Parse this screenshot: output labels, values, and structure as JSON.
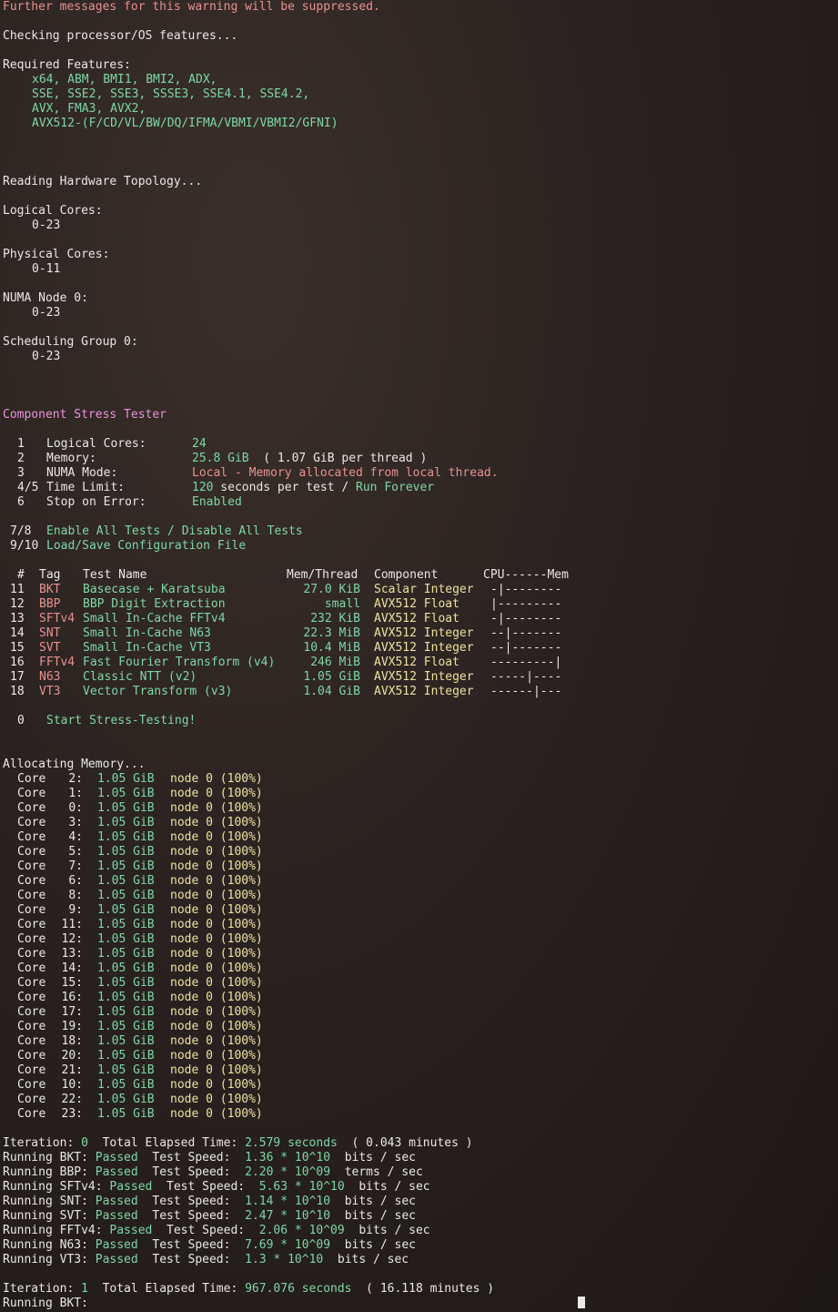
{
  "colors": {
    "text": "#e8e8e8",
    "green": "#7fd6a4",
    "red": "#e7918f",
    "magenta": "#e792d9"
  },
  "header": {
    "suppressed": "Further messages for this warning will be suppressed.",
    "checking": "Checking processor/OS features...",
    "required_title": "Required Features:",
    "features": [
      "x64, ABM, BMI1, BMI2, ADX,",
      "SSE, SSE2, SSE3, SSSE3, SSE4.1, SSE4.2,",
      "AVX, FMA3, AVX2,",
      "AVX512-(F/CD/VL/BW/DQ/IFMA/VBMI/VBMI2/GFNI)"
    ],
    "reading": "Reading Hardware Topology...",
    "topology": [
      {
        "label": "Logical Cores:",
        "value": "0-23"
      },
      {
        "label": "Physical Cores:",
        "value": "0-11"
      },
      {
        "label": "NUMA Node 0:",
        "value": "0-23"
      },
      {
        "label": "Scheduling Group 0:",
        "value": "0-23"
      }
    ]
  },
  "tester": {
    "title": "Component Stress Tester",
    "settings": [
      {
        "num": "1",
        "label": "Logical Cores:",
        "value": "24",
        "suffix": ""
      },
      {
        "num": "2",
        "label": "Memory:",
        "value": "25.8 GiB",
        "suffix": "  ( 1.07 GiB per thread )"
      },
      {
        "num": "3",
        "label": "NUMA Mode:",
        "value": "Local - Memory allocated from local thread.",
        "suffix": ""
      },
      {
        "num": "4/5",
        "label": "Time Limit:",
        "value": "120",
        "suffix": " seconds per test / ",
        "extra": "Run Forever"
      },
      {
        "num": "6",
        "label": "Stop on Error:",
        "value": "Enabled",
        "suffix": ""
      }
    ],
    "opt_78_num": "7/8",
    "opt_78": "Enable All Tests / Disable All Tests",
    "opt_910_num": "9/10",
    "opt_910": "Load/Save Configuration File",
    "columns": {
      "num": "#",
      "tag": "Tag",
      "name": "Test Name",
      "mem": "Mem/Thread",
      "comp": "Component",
      "bar": "CPU------Mem"
    },
    "tests": [
      {
        "num": "11",
        "tag": "BKT",
        "name": "Basecase + Karatsuba",
        "mem": "27.0 KiB",
        "comp": "Scalar Integer",
        "bar": "-|--------"
      },
      {
        "num": "12",
        "tag": "BBP",
        "name": "BBP Digit Extraction",
        "mem": "small",
        "comp": "AVX512 Float",
        "bar": "|---------"
      },
      {
        "num": "13",
        "tag": "SFTv4",
        "name": "Small In-Cache FFTv4",
        "mem": "232 KiB",
        "comp": "AVX512 Float",
        "bar": "-|--------"
      },
      {
        "num": "14",
        "tag": "SNT",
        "name": "Small In-Cache N63",
        "mem": "22.3 MiB",
        "comp": "AVX512 Integer",
        "bar": "--|-------"
      },
      {
        "num": "15",
        "tag": "SVT",
        "name": "Small In-Cache VT3",
        "mem": "10.4 MiB",
        "comp": "AVX512 Integer",
        "bar": "--|-------"
      },
      {
        "num": "16",
        "tag": "FFTv4",
        "name": "Fast Fourier Transform (v4)",
        "mem": "246 MiB",
        "comp": "AVX512 Float",
        "bar": "---------|"
      },
      {
        "num": "17",
        "tag": "N63",
        "name": "Classic NTT (v2)",
        "mem": "1.05 GiB",
        "comp": "AVX512 Integer",
        "bar": "-----|----"
      },
      {
        "num": "18",
        "tag": "VT3",
        "name": "Vector Transform (v3)",
        "mem": "1.04 GiB",
        "comp": "AVX512 Integer",
        "bar": "------|---"
      }
    ],
    "start_num": "0",
    "start": "Start Stress-Testing!"
  },
  "allocating": {
    "title": "Allocating Memory...",
    "core_label": "Core",
    "amount": "1.05 GiB",
    "node": "node 0 (100%)",
    "cores": [
      "2:",
      "1:",
      "0:",
      "3:",
      "4:",
      "5:",
      "7:",
      "6:",
      "8:",
      "9:",
      "11:",
      "12:",
      "13:",
      "14:",
      "15:",
      "16:",
      "17:",
      "19:",
      "18:",
      "20:",
      "21:",
      "10:",
      "22:",
      "23:"
    ]
  },
  "iterations": [
    {
      "label": "Iteration: ",
      "num": "0",
      "elapsed_label": "  Total Elapsed Time: ",
      "seconds": "2.579 seconds",
      "minutes": "  ( 0.043 minutes )",
      "runs": [
        {
          "tag": "Running BKT: ",
          "status": "Passed",
          "speed_label": "  Test Speed:  ",
          "speed": "1.36 * 10^10",
          "unit": "  bits / sec"
        },
        {
          "tag": "Running BBP: ",
          "status": "Passed",
          "speed_label": "  Test Speed:  ",
          "speed": "2.20 * 10^09",
          "unit": "  terms / sec"
        },
        {
          "tag": "Running SFTv4: ",
          "status": "Passed",
          "speed_label": "  Test Speed:  ",
          "speed": "5.63 * 10^10",
          "unit": "  bits / sec"
        },
        {
          "tag": "Running SNT: ",
          "status": "Passed",
          "speed_label": "  Test Speed:  ",
          "speed": "1.14 * 10^10",
          "unit": "  bits / sec"
        },
        {
          "tag": "Running SVT: ",
          "status": "Passed",
          "speed_label": "  Test Speed:  ",
          "speed": "2.47 * 10^10",
          "unit": "  bits / sec"
        },
        {
          "tag": "Running FFTv4: ",
          "status": "Passed",
          "speed_label": "  Test Speed:  ",
          "speed": "2.06 * 10^09",
          "unit": "  bits / sec"
        },
        {
          "tag": "Running N63: ",
          "status": "Passed",
          "speed_label": "  Test Speed:  ",
          "speed": "7.69 * 10^09",
          "unit": "  bits / sec"
        },
        {
          "tag": "Running VT3: ",
          "status": "Passed",
          "speed_label": "  Test Speed:  ",
          "speed": "1.3 * 10^10",
          "unit": "  bits / sec"
        }
      ]
    },
    {
      "label": "Iteration: ",
      "num": "1",
      "elapsed_label": "  Total Elapsed Time: ",
      "seconds": "967.076 seconds",
      "minutes": "  ( 16.118 minutes )",
      "runs": [
        {
          "tag": "Running BKT:",
          "status": "",
          "speed_label": "",
          "speed": "",
          "unit": ""
        }
      ]
    }
  ]
}
